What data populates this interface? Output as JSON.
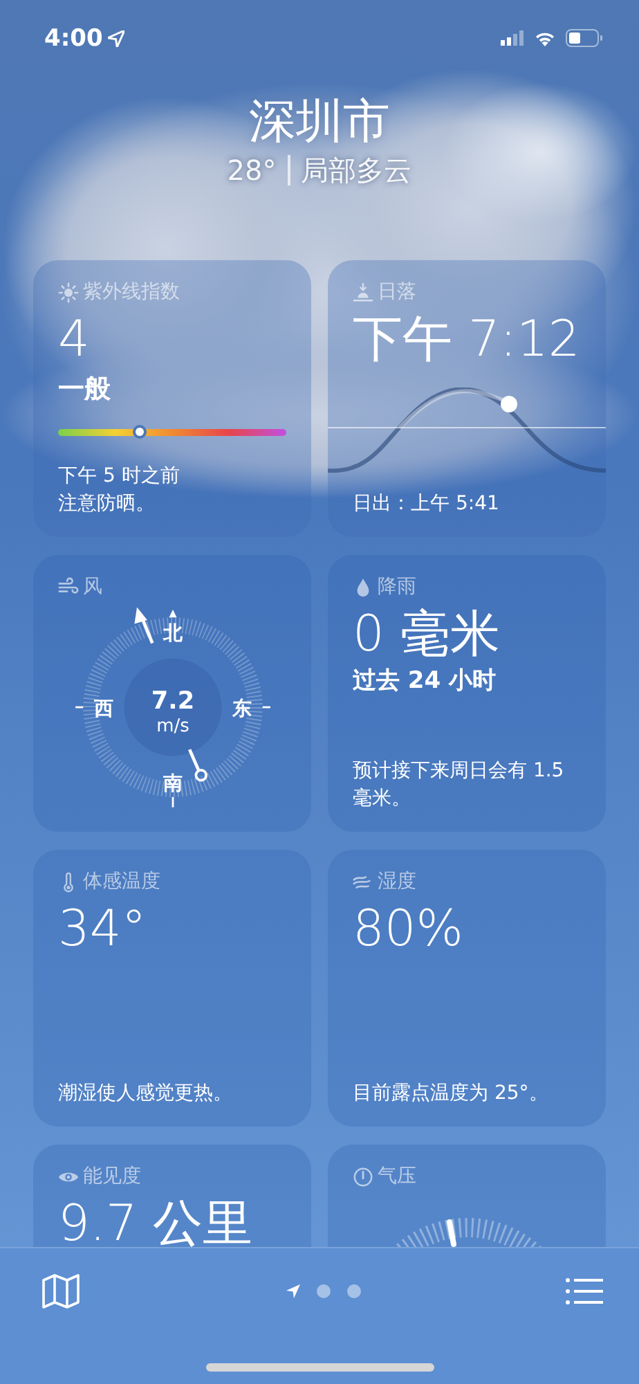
{
  "status_bar": {
    "time": "4:00"
  },
  "header": {
    "city": "深圳市",
    "temperature": "28°",
    "condition": "局部多云"
  },
  "cards": [
    {
      "kind": "uv",
      "title": "紫外线指数",
      "value": "4",
      "level_label": "一般",
      "level": 0.36,
      "note_lines": [
        "下午 5 时之前",
        "注意防晒。"
      ]
    },
    {
      "kind": "sunset",
      "title": "日落",
      "value": "下午 7:12",
      "note": "日出：上午 5:41"
    },
    {
      "kind": "wind",
      "title": "风",
      "speed": "7.2",
      "unit": "m/s",
      "north": "北",
      "south": "南",
      "east": "东",
      "west": "西"
    },
    {
      "kind": "rain",
      "title": "降雨",
      "value": "0 毫米",
      "subtitle": "过去 24 小时",
      "note": "预计接下来周日会有 1.5 毫米。"
    },
    {
      "kind": "feels",
      "title": "体感温度",
      "value": "34°",
      "note": "潮湿使人感觉更热。"
    },
    {
      "kind": "humidity",
      "title": "湿度",
      "value": "80%",
      "note": "目前露点温度为 25°。"
    },
    {
      "kind": "visibility",
      "title": "能见度",
      "value": "9.7 公里"
    },
    {
      "kind": "pressure",
      "title": "气压"
    }
  ],
  "page_indicator": [
    {
      "kind": "location",
      "selected": true
    },
    {
      "kind": "dot",
      "selected": false
    },
    {
      "kind": "dot",
      "selected": false
    }
  ]
}
